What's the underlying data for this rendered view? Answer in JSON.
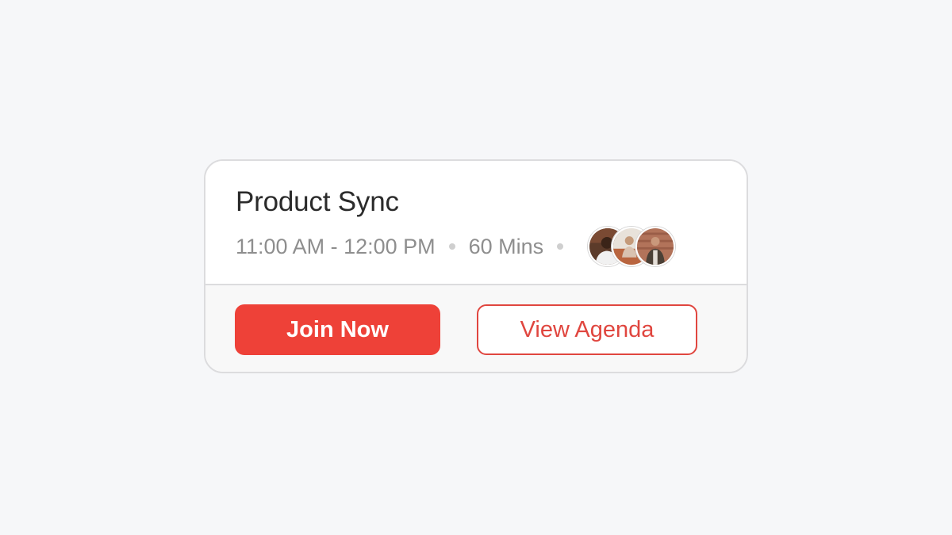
{
  "meeting": {
    "title": "Product Sync",
    "time_range": "11:00 AM - 12:00 PM",
    "duration": "60 Mins",
    "attendees": [
      {
        "icon": "attendee-avatar-1"
      },
      {
        "icon": "attendee-avatar-2"
      },
      {
        "icon": "attendee-avatar-3"
      }
    ]
  },
  "actions": {
    "join_label": "Join Now",
    "agenda_label": "View Agenda"
  },
  "colors": {
    "accent": "#ee4138",
    "background": "#f6f7f9"
  }
}
